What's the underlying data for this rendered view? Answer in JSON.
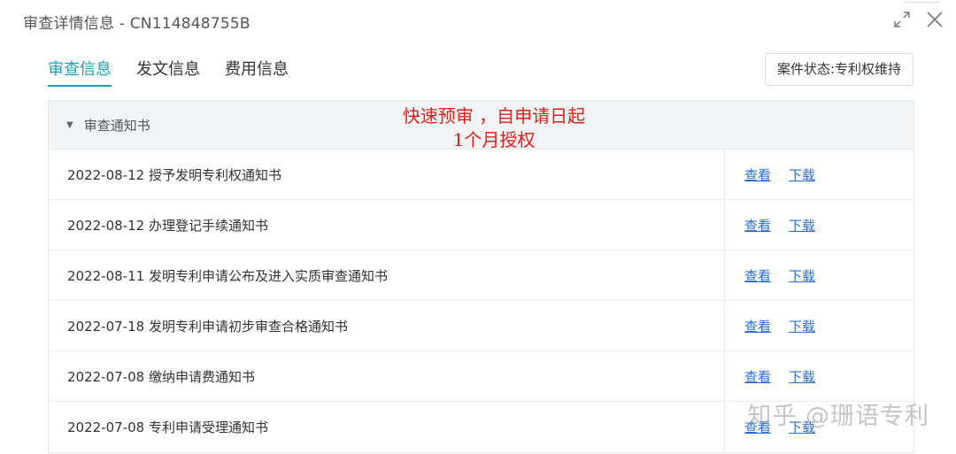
{
  "window": {
    "title": "审查详情信息 - CN114848755B"
  },
  "tabs": [
    {
      "label": "审查信息",
      "active": true
    },
    {
      "label": "发文信息",
      "active": false
    },
    {
      "label": "费用信息",
      "active": false
    }
  ],
  "case_status": "案件状态:专利权维持",
  "section": {
    "title": "审查通知书",
    "rows": [
      {
        "text": "2022-08-12 授予发明专利权通知书",
        "view": "查看",
        "download": "下载"
      },
      {
        "text": "2022-08-12 办理登记手续通知书",
        "view": "查看",
        "download": "下载"
      },
      {
        "text": "2022-08-11 发明专利申请公布及进入实质审查通知书",
        "view": "查看",
        "download": "下载"
      },
      {
        "text": "2022-07-18 发明专利申请初步审查合格通知书",
        "view": "查看",
        "download": "下载"
      },
      {
        "text": "2022-07-08 缴纳申请费通知书",
        "view": "查看",
        "download": "下载"
      },
      {
        "text": "2022-07-08 专利申请受理通知书",
        "view": "查看",
        "download": "下载"
      }
    ]
  },
  "annotation": {
    "line1": "快速预审 ，自申请日起",
    "line2": "1个月授权",
    "color": "#e0201a"
  },
  "watermark": "知乎 @珊语专利",
  "colors": {
    "accent": "#1aa3b8",
    "link": "#2a6fd6"
  }
}
